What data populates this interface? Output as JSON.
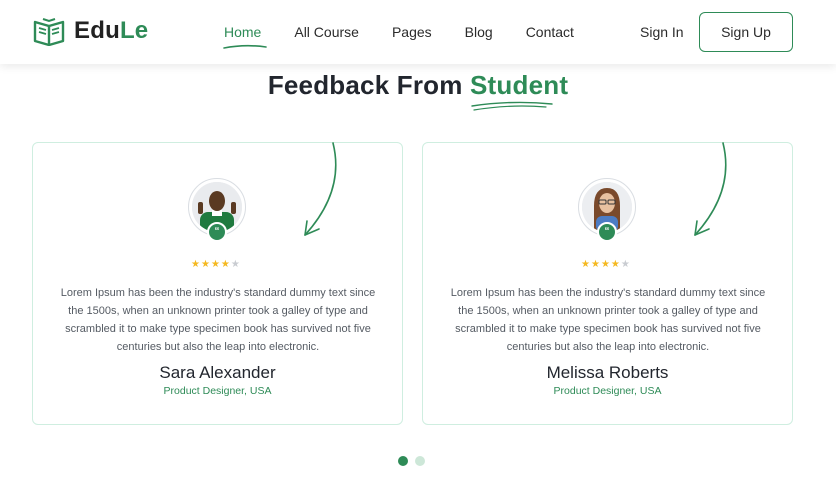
{
  "brand": {
    "part1": "Edu",
    "part2": "Le",
    "accent_color": "#2e8b57"
  },
  "nav": {
    "items": [
      {
        "label": "Home",
        "active": true
      },
      {
        "label": "All Course",
        "active": false
      },
      {
        "label": "Pages",
        "active": false
      },
      {
        "label": "Blog",
        "active": false
      },
      {
        "label": "Contact",
        "active": false
      }
    ],
    "signin_label": "Sign In",
    "signup_label": "Sign Up"
  },
  "section": {
    "title_prefix": "Feedback From ",
    "title_highlight": "Student"
  },
  "testimonials": [
    {
      "name": "Sara Alexander",
      "role": "Product Designer, USA",
      "rating": 4,
      "rating_max": 5,
      "text": "Lorem Ipsum has been the industry's standard dummy text since the 1500s, when an unknown printer took a galley of type and scrambled it to make type specimen book has survived not five centuries but also the leap into electronic.",
      "quote_glyph": "“"
    },
    {
      "name": "Melissa Roberts",
      "role": "Product Designer, USA",
      "rating": 4,
      "rating_max": 5,
      "text": "Lorem Ipsum has been the industry's standard dummy text since the 1500s, when an unknown printer took a galley of type and scrambled it to make type specimen book has survived not five centuries but also the leap into electronic.",
      "quote_glyph": "“"
    }
  ],
  "pagination": {
    "total": 2,
    "active_index": 0
  }
}
